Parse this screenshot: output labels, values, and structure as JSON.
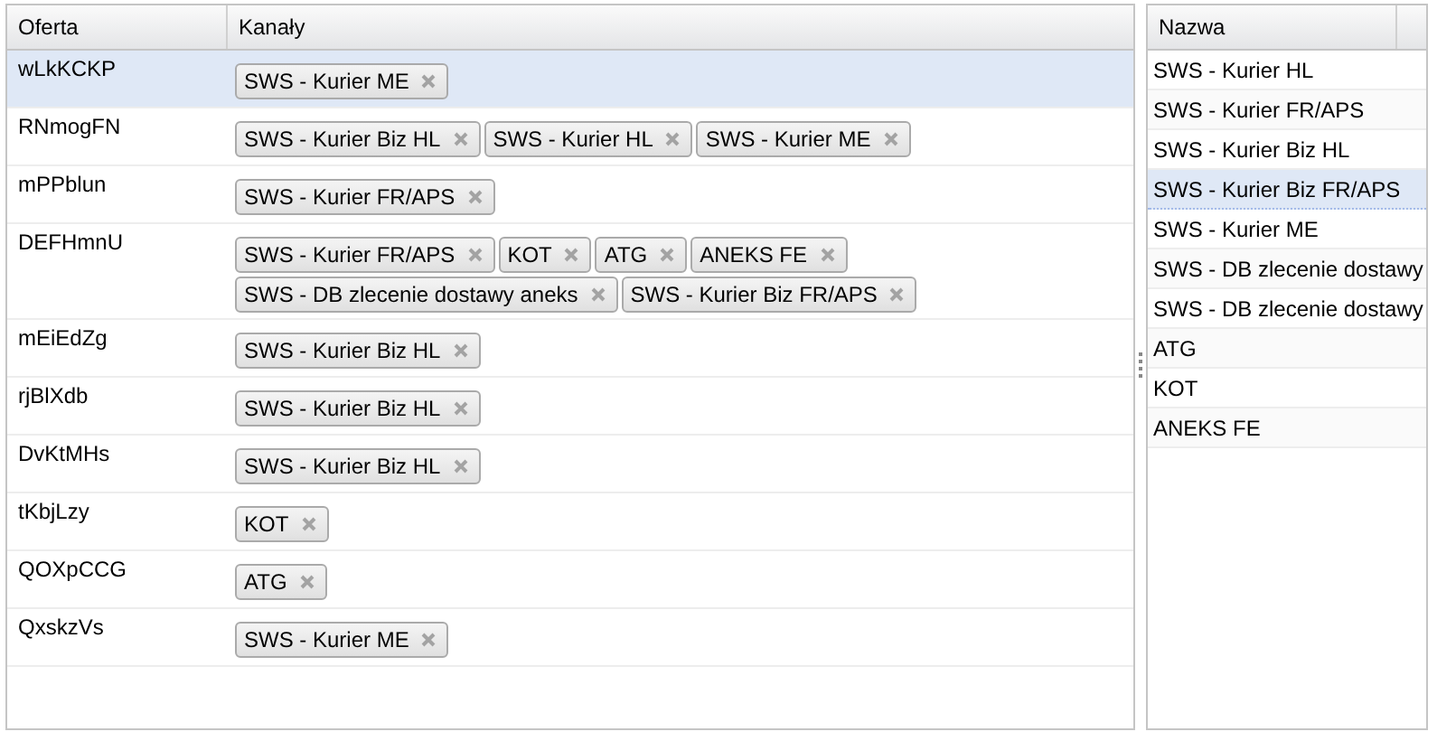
{
  "offers_grid": {
    "columns": [
      "Oferta",
      "Kanały"
    ],
    "rows": [
      {
        "name": "wLkKCKP",
        "selected": true,
        "channels": [
          "SWS - Kurier ME"
        ]
      },
      {
        "name": "RNmogFN",
        "selected": false,
        "channels": [
          "SWS - Kurier Biz HL",
          "SWS - Kurier HL",
          "SWS - Kurier ME"
        ]
      },
      {
        "name": "mPPblun",
        "selected": false,
        "channels": [
          "SWS - Kurier FR/APS"
        ]
      },
      {
        "name": "DEFHmnU",
        "selected": false,
        "channels": [
          "SWS - Kurier FR/APS",
          "KOT",
          "ATG",
          "ANEKS FE",
          "SWS - DB zlecenie dostawy aneks",
          "SWS - Kurier Biz FR/APS"
        ]
      },
      {
        "name": "mEiEdZg",
        "selected": false,
        "channels": [
          "SWS - Kurier Biz HL"
        ]
      },
      {
        "name": "rjBlXdb",
        "selected": false,
        "channels": [
          "SWS - Kurier Biz HL"
        ]
      },
      {
        "name": "DvKtMHs",
        "selected": false,
        "channels": [
          "SWS - Kurier Biz HL"
        ]
      },
      {
        "name": "tKbjLzy",
        "selected": false,
        "channels": [
          "KOT"
        ]
      },
      {
        "name": "QOXpCCG",
        "selected": false,
        "channels": [
          "ATG"
        ]
      },
      {
        "name": "QxskzVs",
        "selected": false,
        "channels": [
          "SWS - Kurier ME"
        ]
      }
    ]
  },
  "channels_list": {
    "column": "Nazwa",
    "items": [
      {
        "label": "SWS - Kurier HL",
        "selected": false
      },
      {
        "label": "SWS - Kurier FR/APS",
        "selected": false
      },
      {
        "label": "SWS - Kurier Biz HL",
        "selected": false
      },
      {
        "label": "SWS - Kurier Biz FR/APS",
        "selected": true
      },
      {
        "label": "SWS - Kurier ME",
        "selected": false
      },
      {
        "label": "SWS - DB zlecenie dostawy",
        "selected": false
      },
      {
        "label": "SWS - DB zlecenie dostawy",
        "selected": false
      },
      {
        "label": "ATG",
        "selected": false
      },
      {
        "label": "KOT",
        "selected": false
      },
      {
        "label": "ANEKS FE",
        "selected": false
      }
    ]
  }
}
